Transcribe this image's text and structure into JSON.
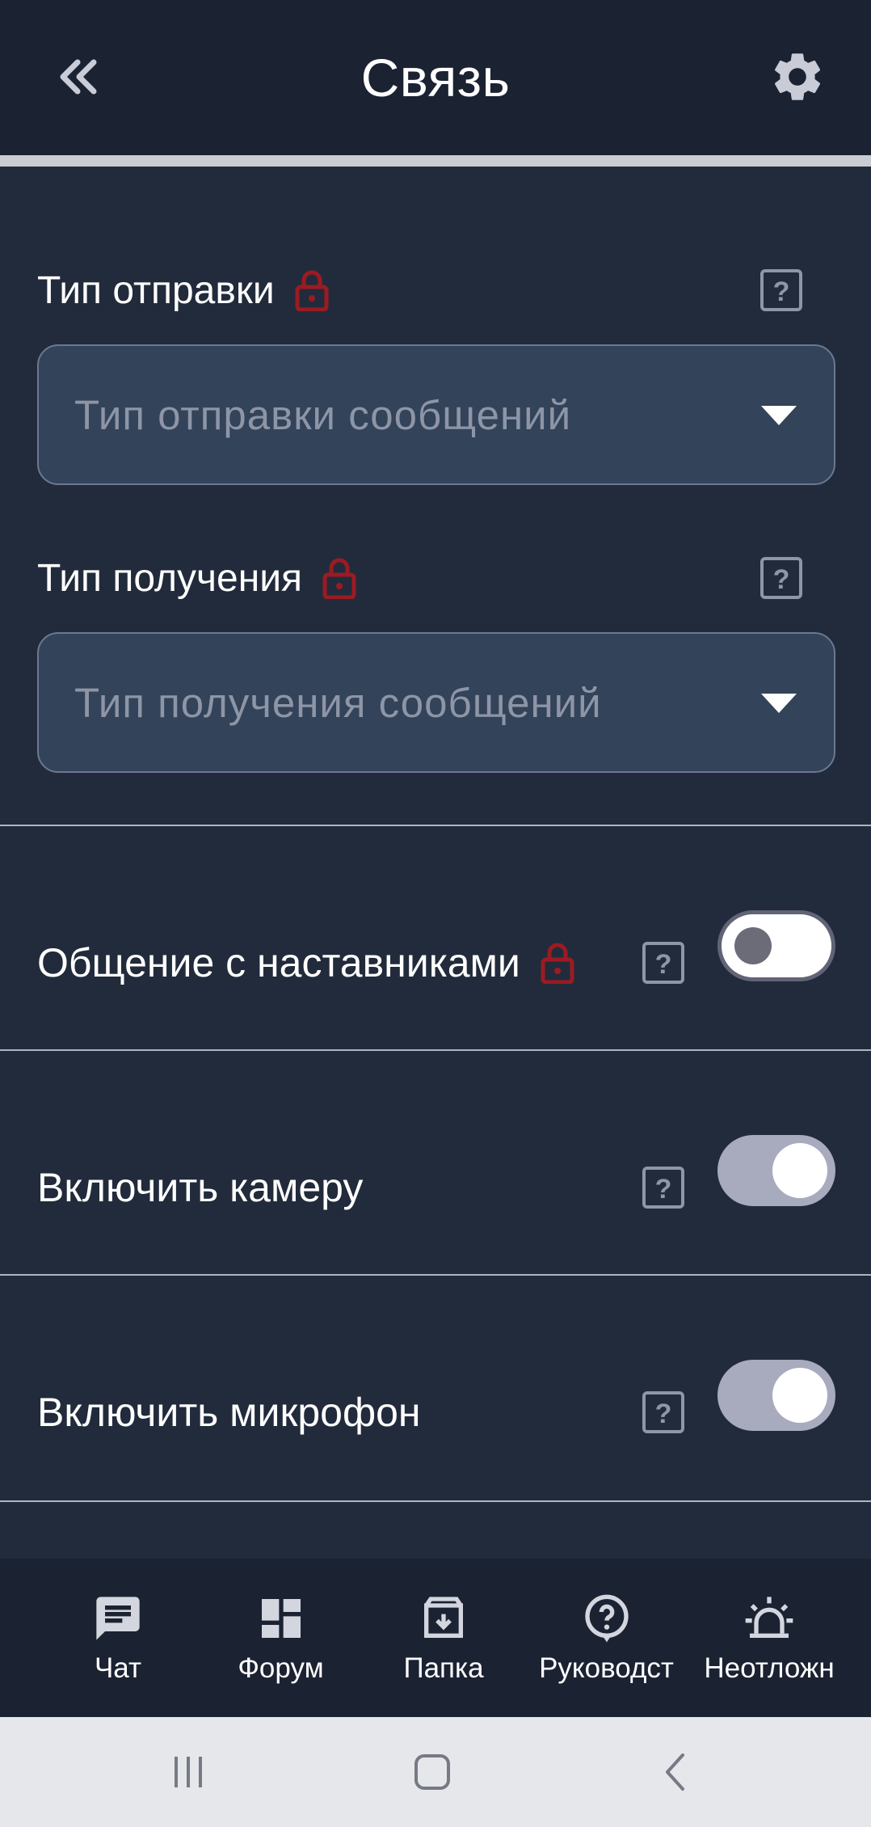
{
  "header": {
    "title": "Связь",
    "back_icon": "double-chevron-left-icon",
    "settings_icon": "gear-icon"
  },
  "fields": [
    {
      "label": "Тип отправки",
      "placeholder": "Тип отправки сообщений",
      "locked": true
    },
    {
      "label": "Тип получения",
      "placeholder": "Тип получения сообщений",
      "locked": true
    }
  ],
  "switches": [
    {
      "label": "Общение с наставниками",
      "locked": true,
      "on": false
    },
    {
      "label": "Включить камеру",
      "locked": false,
      "on": true
    },
    {
      "label": "Включить микрофон",
      "locked": false,
      "on": true
    }
  ],
  "bottom_nav": [
    {
      "label": "Чат",
      "icon": "chat-icon"
    },
    {
      "label": "Форум",
      "icon": "dashboard-icon"
    },
    {
      "label": "Папка",
      "icon": "archive-icon"
    },
    {
      "label": "Руководст",
      "icon": "help-circle-icon"
    },
    {
      "label": "Неотложн",
      "icon": "siren-icon"
    }
  ],
  "colors": {
    "background": "#222b3b",
    "header": "#1b2232",
    "field": "#334359",
    "lock": "#9b1b22",
    "toggle_on": "#a8abbd"
  }
}
